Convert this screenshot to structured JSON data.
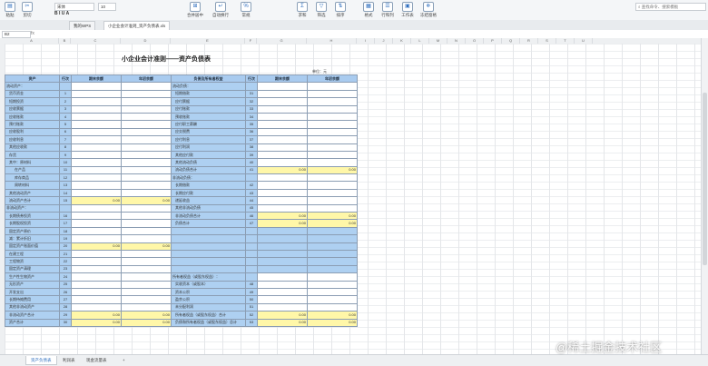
{
  "toolbar": {
    "font_name": "宋体",
    "font_size": "10",
    "paste_label": "粘贴",
    "cut_label": "剪切",
    "buttons": [
      "合并居中",
      "自动换行",
      "常规",
      "求和",
      "筛选",
      "排序",
      "格式",
      "行和列",
      "工作表",
      "冻结窗格"
    ],
    "search_placeholder": "查找命令、搜索模板"
  },
  "workbook_tabs": [
    "我的WPS",
    "小企业会计准则_资产负债表.xls"
  ],
  "formula": {
    "cell": "B2",
    "fx": "fx"
  },
  "columns": [
    "A",
    "B",
    "C",
    "D",
    "E",
    "F",
    "G",
    "H",
    "I",
    "J",
    "K",
    "L",
    "M",
    "N",
    "O",
    "P",
    "Q",
    "R",
    "S",
    "T",
    "U"
  ],
  "title": "小企业会计准则——资产负债表",
  "unit_label": "单位：元",
  "headers": [
    "资产",
    "行次",
    "期末余额",
    "年初余额",
    "负债及所有者权益",
    "行次",
    "期末余额",
    "年初余额"
  ],
  "rows": [
    [
      "流动资产：",
      "",
      "",
      "",
      "流动负债：",
      "",
      "",
      ""
    ],
    [
      "货币资金",
      "1",
      "",
      "",
      "短期借款",
      "31",
      "",
      ""
    ],
    [
      "短期投资",
      "2",
      "",
      "",
      "应付票据",
      "32",
      "",
      ""
    ],
    [
      "应收票据",
      "3",
      "",
      "",
      "应付账款",
      "33",
      "",
      ""
    ],
    [
      "应收账款",
      "4",
      "",
      "",
      "预收账款",
      "34",
      "",
      ""
    ],
    [
      "预付账款",
      "5",
      "",
      "",
      "应付职工薪酬",
      "35",
      "",
      ""
    ],
    [
      "应收股利",
      "6",
      "",
      "",
      "应交税费",
      "36",
      "",
      ""
    ],
    [
      "应收利息",
      "7",
      "",
      "",
      "应付利息",
      "37",
      "",
      ""
    ],
    [
      "其他应收款",
      "8",
      "",
      "",
      "应付利润",
      "38",
      "",
      ""
    ],
    [
      "存货",
      "9",
      "",
      "",
      "其他应付款",
      "39",
      "",
      ""
    ],
    [
      "其中：原材料",
      "10",
      "",
      "",
      "其他流动负债",
      "40",
      "",
      ""
    ],
    [
      "在产品",
      "11",
      "",
      "",
      "流动负债合计",
      "41",
      "0.00",
      "0.00"
    ],
    [
      "库存商品",
      "12",
      "",
      "",
      "非流动负债：",
      "",
      "",
      ""
    ],
    [
      "周转材料",
      "13",
      "",
      "",
      "长期借款",
      "42",
      "",
      ""
    ],
    [
      "其他流动资产",
      "14",
      "",
      "",
      "长期应付款",
      "43",
      "",
      ""
    ],
    [
      "流动资产合计",
      "15",
      "0.00",
      "0.00",
      "递延收益",
      "44",
      "",
      ""
    ],
    [
      "非流动资产：",
      "",
      "",
      "",
      "其他非流动负债",
      "45",
      "",
      ""
    ],
    [
      "长期债券投资",
      "16",
      "",
      "",
      "非流动负债合计",
      "46",
      "0.00",
      "0.00"
    ],
    [
      "长期股权投资",
      "17",
      "",
      "",
      "负债合计",
      "47",
      "0.00",
      "0.00"
    ],
    [
      "固定资产原价",
      "18",
      "",
      "",
      "",
      "",
      "",
      ""
    ],
    [
      "减：累计折旧",
      "19",
      "",
      "",
      "",
      "",
      "",
      ""
    ],
    [
      "固定资产账面价值",
      "20",
      "0.00",
      "0.00",
      "",
      "",
      "",
      ""
    ],
    [
      "在建工程",
      "21",
      "",
      "",
      "",
      "",
      "",
      ""
    ],
    [
      "工程物资",
      "22",
      "",
      "",
      "",
      "",
      "",
      ""
    ],
    [
      "固定资产清理",
      "23",
      "",
      "",
      "",
      "",
      "",
      ""
    ],
    [
      "生产性生物资产",
      "24",
      "",
      "",
      "所有者权益（或股东权益）：",
      "",
      "",
      ""
    ],
    [
      "无形资产",
      "25",
      "",
      "",
      "实收资本（或股本）",
      "48",
      "",
      ""
    ],
    [
      "开发支出",
      "26",
      "",
      "",
      "资本公积",
      "49",
      "",
      ""
    ],
    [
      "长期待摊费用",
      "27",
      "",
      "",
      "盈余公积",
      "50",
      "",
      ""
    ],
    [
      "其他非流动资产",
      "28",
      "",
      "",
      "未分配利润",
      "51",
      "",
      ""
    ],
    [
      "非流动资产合计",
      "29",
      "0.00",
      "0.00",
      "所有者权益（或股东权益）合计",
      "52",
      "0.00",
      "0.00"
    ],
    [
      "资产合计",
      "30",
      "0.00",
      "0.00",
      "负债和所有者权益（或股东权益）总计",
      "53",
      "0.00",
      "0.00"
    ]
  ],
  "sheet_tabs": [
    "资产负债表",
    "利润表",
    "现金流量表"
  ],
  "add_sheet": "+",
  "watermark": "@稀土掘金技术社区"
}
